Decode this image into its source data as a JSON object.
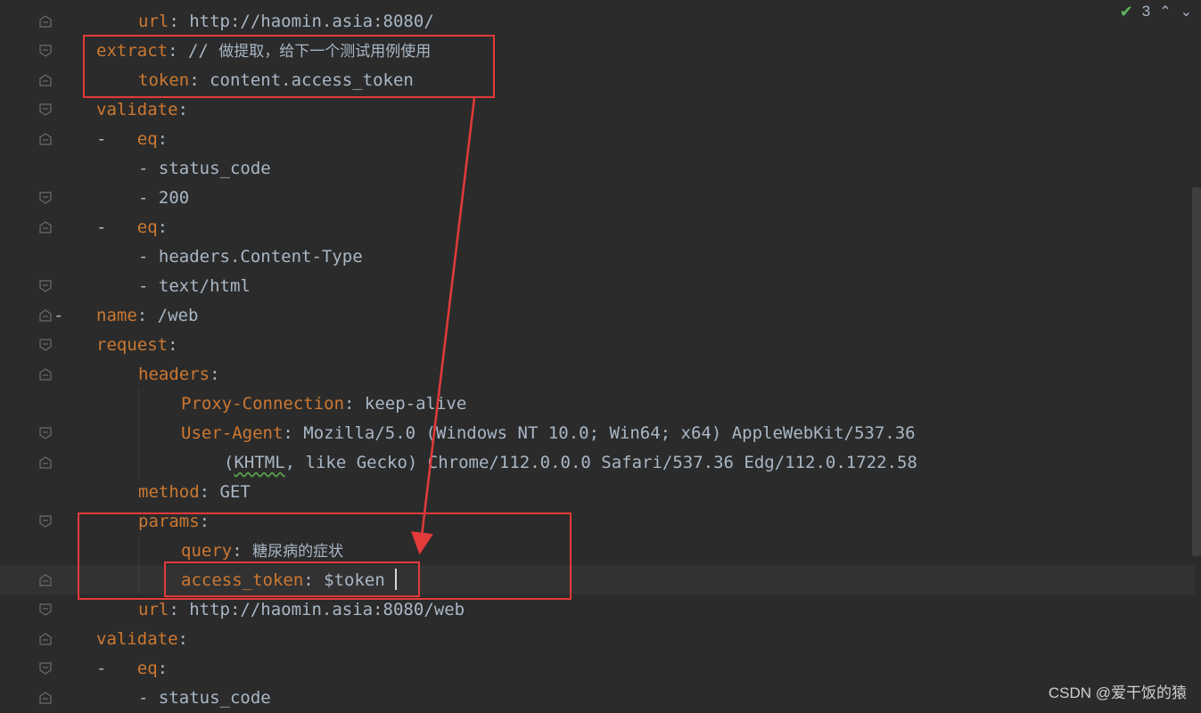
{
  "status": {
    "check_count": "3"
  },
  "watermark": "CSDN @爱干饭的猿",
  "code": {
    "l0": {
      "key": "url",
      "sep": ": ",
      "val": "http://haomin.asia:8080/"
    },
    "l1": {
      "key": "extract",
      "sep": ": // ",
      "val": "做提取，给下一个测试用例使用"
    },
    "l2": {
      "key": "token",
      "sep": ": ",
      "val": "content.access_token"
    },
    "l3": {
      "key": "validate",
      "sep": ":"
    },
    "l4": {
      "dash": "-   ",
      "key": "eq",
      "sep": ":"
    },
    "l5": {
      "val": "- status_code"
    },
    "l6": {
      "val": "- 200"
    },
    "l7": {
      "dash": "-   ",
      "key": "eq",
      "sep": ":"
    },
    "l8": {
      "val": "- headers.Content-Type"
    },
    "l9": {
      "val": "- text/html"
    },
    "l10": {
      "key": "name",
      "sep": ": ",
      "val": "/web"
    },
    "l11": {
      "key": "request",
      "sep": ":"
    },
    "l12": {
      "key": "headers",
      "sep": ":"
    },
    "l13": {
      "key": "Proxy-Connection",
      "sep": ": ",
      "val": "keep-alive"
    },
    "l14": {
      "key": "User-Agent",
      "sep": ": ",
      "val": "Mozilla/5.0 (Windows NT 10.0; Win64; x64) AppleWebKit/537.36"
    },
    "l15": {
      "val_a": "(",
      "val_b": "KHTML",
      "val_c": ", like Gecko) Chrome/112.0.0.0 Safari/537.36 Edg/112.0.1722.58"
    },
    "l16": {
      "key": "method",
      "sep": ": ",
      "val": "GET"
    },
    "l17": {
      "key": "params",
      "sep": ":"
    },
    "l18": {
      "key": "query",
      "sep": ": ",
      "val": "糖尿病的症状"
    },
    "l19": {
      "key": "access_token",
      "sep": ": ",
      "val": "$token"
    },
    "l20": {
      "key": "url",
      "sep": ": ",
      "val": "http://haomin.asia:8080/web"
    },
    "l21": {
      "key": "validate",
      "sep": ":"
    },
    "l22": {
      "dash": "-   ",
      "key": "eq",
      "sep": ":"
    },
    "l23": {
      "val": "- status_code"
    },
    "gutter_dash": "-"
  }
}
